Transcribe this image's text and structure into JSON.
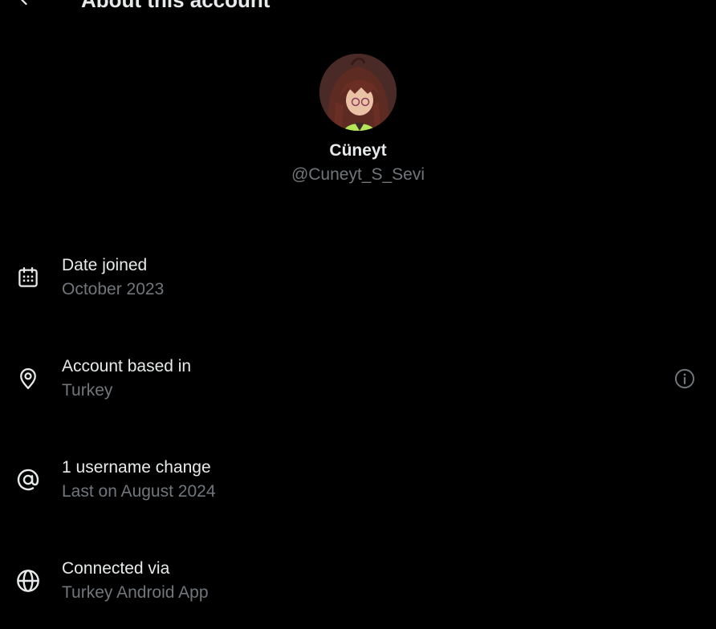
{
  "header": {
    "title": "About this account",
    "back_icon": "arrow-left-icon"
  },
  "profile": {
    "display_name": "Cüneyt",
    "handle": "@Cuneyt_S_Sevi",
    "avatar_icon": "avatar-image"
  },
  "rows": [
    {
      "label": "Date joined",
      "value": "October 2023",
      "icon": "calendar-icon"
    },
    {
      "label": "Account based in",
      "value": "Turkey",
      "icon": "location-pin-icon",
      "info_icon": "info-icon"
    },
    {
      "label": "1 username change",
      "value": "Last on August 2024",
      "icon": "at-sign-icon"
    },
    {
      "label": "Connected via",
      "value": "Turkey Android App",
      "icon": "globe-icon"
    }
  ],
  "colors": {
    "background": "#000000",
    "primary_text": "#e7e9ea",
    "secondary_text": "#71767b"
  }
}
